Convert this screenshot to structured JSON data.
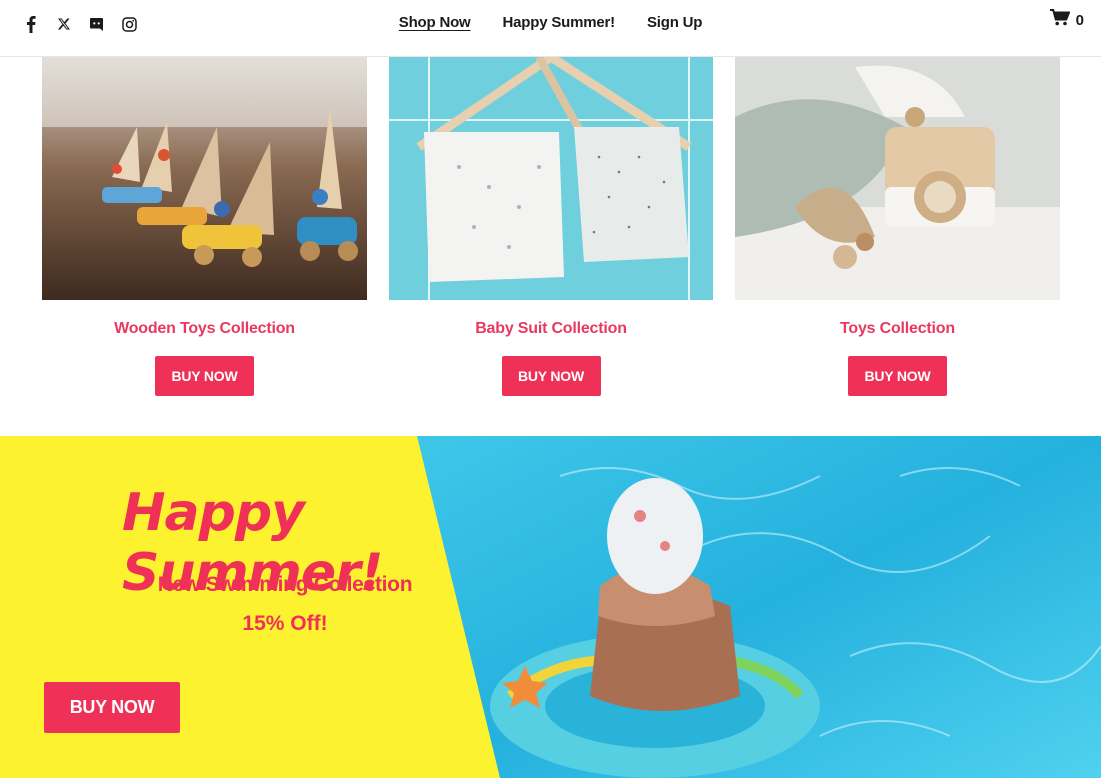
{
  "header": {
    "social": [
      {
        "name": "facebook-icon"
      },
      {
        "name": "x-twitter-icon"
      },
      {
        "name": "discord-icon"
      },
      {
        "name": "instagram-icon"
      }
    ],
    "nav": [
      {
        "label": "Shop Now",
        "active": true
      },
      {
        "label": "Happy Summer!",
        "active": false
      },
      {
        "label": "Sign Up",
        "active": false
      }
    ],
    "cart": {
      "icon": "cart-icon",
      "count": "0"
    }
  },
  "collections": [
    {
      "title": "Wooden Toys Collection",
      "button": "BUY NOW"
    },
    {
      "title": "Baby Suit Collection",
      "button": "BUY NOW"
    },
    {
      "title": "Toys Collection",
      "button": "BUY NOW"
    }
  ],
  "banner": {
    "headline": "Happy Summer!",
    "subtitle": "New Swimming Collection",
    "discount": "15% Off!",
    "button": "BUY NOW"
  },
  "colors": {
    "accent": "#ef3157",
    "banner_yellow": "#fdf22f",
    "pool_blue": "#2ec4e8",
    "text_dark": "#1b1b1b"
  }
}
